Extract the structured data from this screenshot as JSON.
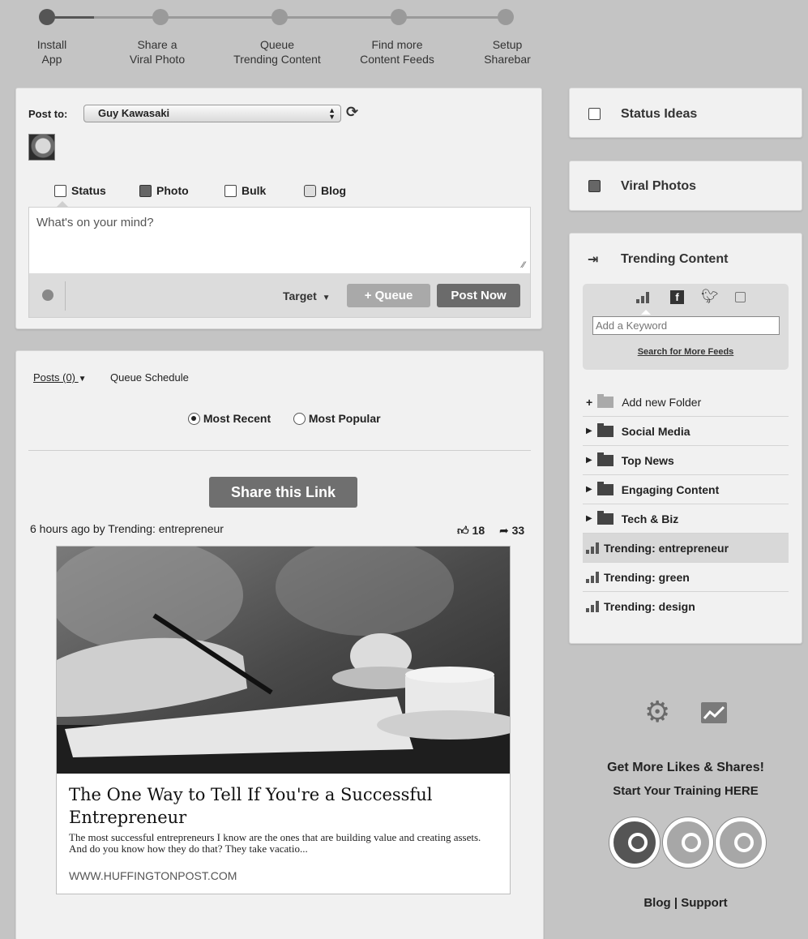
{
  "steps": [
    {
      "label_1": "Install",
      "label_2": "App"
    },
    {
      "label_1": "Share a",
      "label_2": "Viral Photo"
    },
    {
      "label_1": "Queue",
      "label_2": "Trending Content"
    },
    {
      "label_1": "Find more",
      "label_2": "Content Feeds"
    },
    {
      "label_1": "Setup",
      "label_2": "Sharebar"
    }
  ],
  "composer": {
    "post_to_label": "Post to:",
    "account": "Guy Kawasaki",
    "tabs": [
      "Status",
      "Photo",
      "Bulk",
      "Blog"
    ],
    "placeholder": "What's on your mind?",
    "target_label": "Target",
    "queue_label": "+ Queue",
    "post_now_label": "Post Now"
  },
  "feed": {
    "posts_tab": "Posts (0)",
    "queue_schedule": "Queue Schedule",
    "sort_options": [
      "Most Recent",
      "Most Popular"
    ],
    "share_button": "Share this Link",
    "meta": "6 hours ago by Trending: entrepreneur",
    "likes": "18",
    "shares": "33",
    "article": {
      "title": "The One Way to Tell If You're a Successful Entrepreneur",
      "excerpt": "The most successful entrepreneurs I know are the ones that are building value and creating assets. And do you know how they do that? They take vacatio...",
      "source": "WWW.HUFFINGTONPOST.COM"
    }
  },
  "sidebar": {
    "status_ideas": "Status Ideas",
    "viral_photos": "Viral Photos",
    "trending_content": "Trending Content",
    "keyword_placeholder": "Add a Keyword",
    "search_more": "Search for More Feeds",
    "add_folder": "Add new Folder",
    "folders": [
      "Social Media",
      "Top News",
      "Engaging Content",
      "Tech & Biz"
    ],
    "trending": [
      "Trending: entrepreneur",
      "Trending: green",
      "Trending: design"
    ]
  },
  "promo": {
    "line1": "Get More Likes & Shares!",
    "line2": "Start Your Training HERE",
    "blog": "Blog",
    "separator": "|",
    "support": "Support"
  }
}
